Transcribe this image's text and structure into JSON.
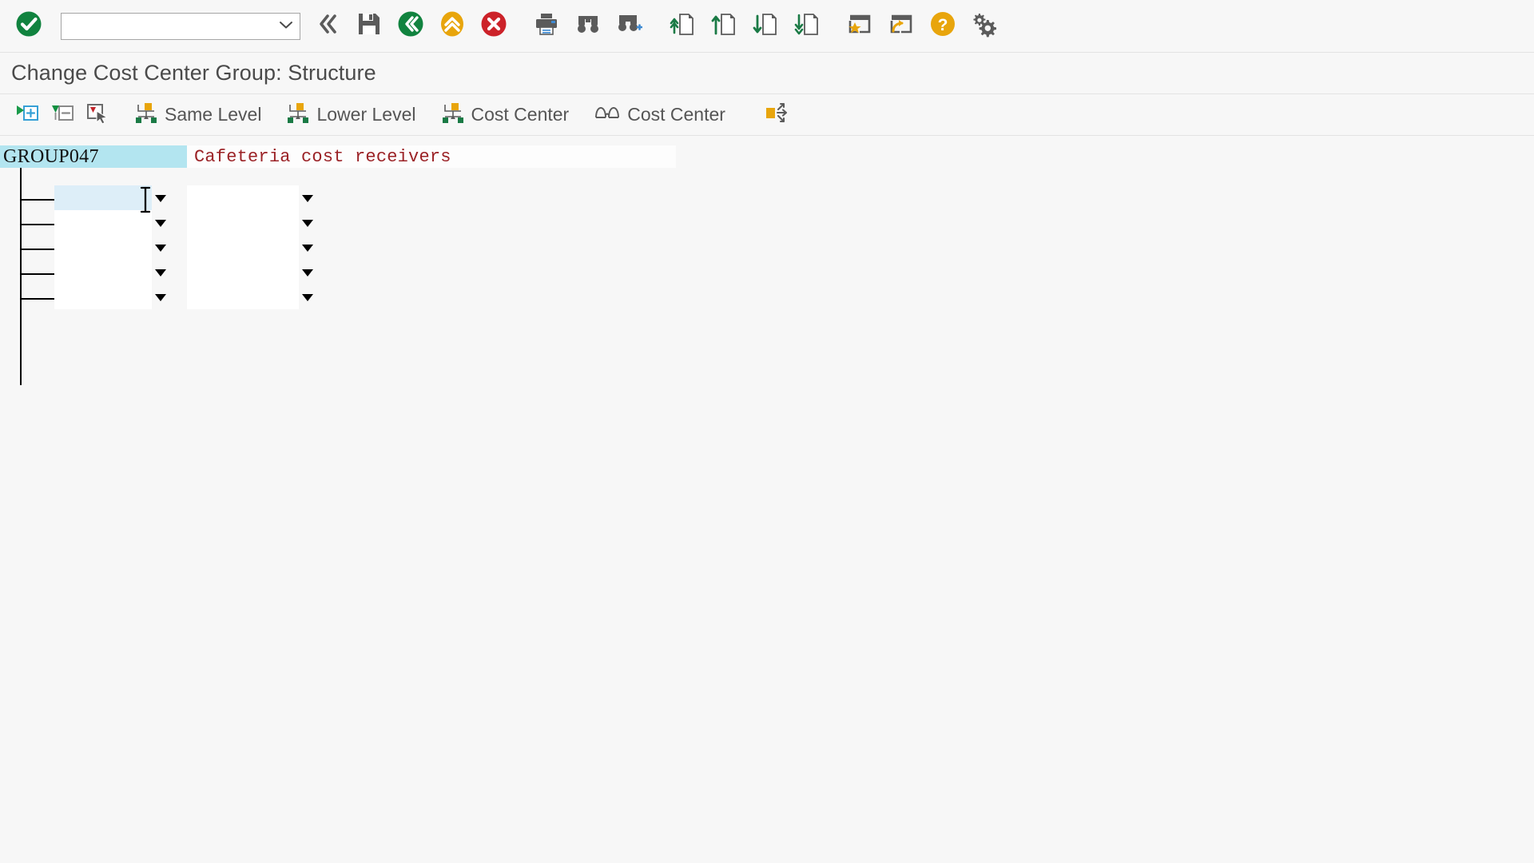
{
  "window": {
    "title": "Change Cost Center Group: Structure"
  },
  "system_toolbar": {
    "ok_button": {
      "name": "enter-ok-icon",
      "label": "Enter"
    },
    "command_field": {
      "value": "",
      "placeholder": ""
    },
    "buttons": [
      {
        "name": "back-icon",
        "label": "Back"
      },
      {
        "name": "save-icon",
        "label": "Save"
      },
      {
        "name": "exit-icon",
        "label": "Exit"
      },
      {
        "name": "cancel-up-icon",
        "label": "Cancel"
      },
      {
        "name": "stop-icon",
        "label": "Stop Transaction"
      },
      {
        "name": "print-icon",
        "label": "Print"
      },
      {
        "name": "find-icon",
        "label": "Find"
      },
      {
        "name": "find-next-icon",
        "label": "Find Next"
      },
      {
        "name": "first-page-icon",
        "label": "First Page"
      },
      {
        "name": "previous-page-icon",
        "label": "Previous Page"
      },
      {
        "name": "next-page-icon",
        "label": "Next Page"
      },
      {
        "name": "last-page-icon",
        "label": "Last Page"
      },
      {
        "name": "create-shortcut-icon",
        "label": "Create Shortcut"
      },
      {
        "name": "new-session-icon",
        "label": "Create New Session"
      },
      {
        "name": "help-icon",
        "label": "Help"
      },
      {
        "name": "customize-icon",
        "label": "Customizing of Local Layout"
      }
    ]
  },
  "application_toolbar": {
    "items": [
      {
        "name": "expand-node-button",
        "icon": "expand-node-icon",
        "label": ""
      },
      {
        "name": "collapse-node-button",
        "icon": "collapse-node-icon",
        "label": ""
      },
      {
        "name": "select-node-button",
        "icon": "select-node-icon",
        "label": ""
      },
      {
        "name": "same-level-button",
        "icon": "hierarchy-icon",
        "label": "Same Level"
      },
      {
        "name": "lower-level-button",
        "icon": "hierarchy-icon",
        "label": "Lower Level"
      },
      {
        "name": "cost-center-insert-button",
        "icon": "hierarchy-icon",
        "label": "Cost Center"
      },
      {
        "name": "cost-center-display-button",
        "icon": "glasses-icon",
        "label": "Cost Center"
      },
      {
        "name": "position-button",
        "icon": "position-arrows-icon",
        "label": ""
      }
    ]
  },
  "structure": {
    "root": {
      "key": "GROUP047",
      "description": "Cafeteria cost receivers"
    },
    "rows": [
      {
        "key": "",
        "description": "",
        "selected": true
      },
      {
        "key": "",
        "description": "",
        "selected": false
      },
      {
        "key": "",
        "description": "",
        "selected": false
      },
      {
        "key": "",
        "description": "",
        "selected": false
      },
      {
        "key": "",
        "description": "",
        "selected": false
      }
    ]
  },
  "colors": {
    "toolbar_background": "#f7f7f7",
    "selected_node_background": "#b3e5f0",
    "selected_field_background": "#ddeef8",
    "description_text": "#9b2226",
    "title_text": "#4a4a4a",
    "icon_green": "#1a7a45",
    "icon_amber": "#e8a50c",
    "icon_red": "#cc2229",
    "icon_gray": "#5b5b5b"
  }
}
